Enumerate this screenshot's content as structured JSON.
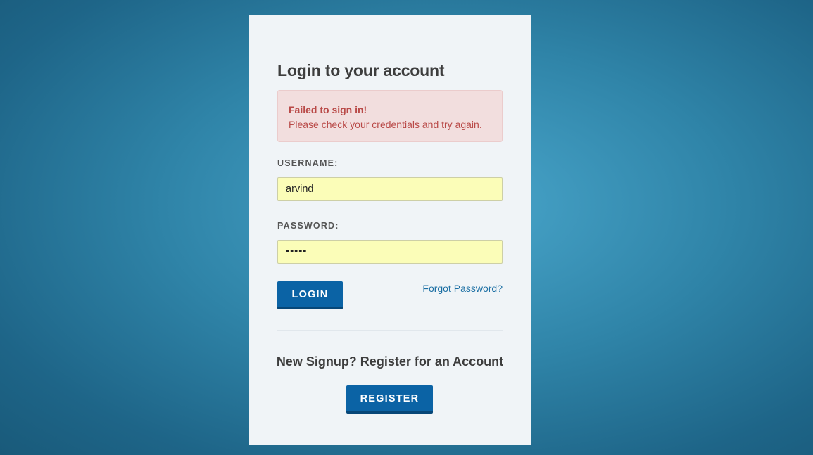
{
  "login": {
    "title": "Login to your account",
    "alert": {
      "title": "Failed to sign in!",
      "message": "Please check your credentials and try again."
    },
    "username": {
      "label": "USERNAME:",
      "value": "arvind"
    },
    "password": {
      "label": "PASSWORD:",
      "value": "•••••"
    },
    "login_button": "LOGIN",
    "forgot_link": "Forgot Password?"
  },
  "signup": {
    "text": "New Signup? Register for an Account",
    "register_button": "REGISTER"
  },
  "colors": {
    "primary_button": "#0b63a5",
    "alert_background": "#f2dede",
    "alert_text": "#b94a48",
    "autofill_background": "#fbfdb8",
    "link": "#1a6ea3"
  }
}
